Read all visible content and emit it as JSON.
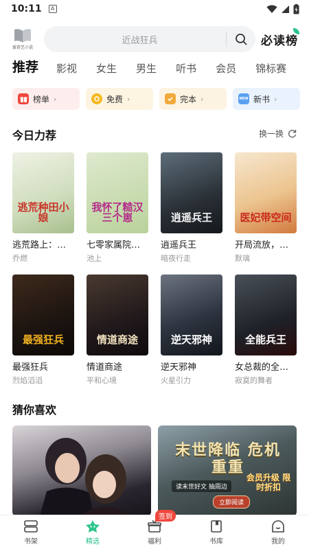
{
  "status_bar": {
    "time": "10:11",
    "notification_letter": "A"
  },
  "header": {
    "logo_caption": "爱奇艺小说",
    "search_placeholder": "近战狂兵",
    "brand": "必读榜"
  },
  "tabs": [
    {
      "label": "推荐",
      "active": true
    },
    {
      "label": "影视"
    },
    {
      "label": "女生"
    },
    {
      "label": "男生"
    },
    {
      "label": "听书"
    },
    {
      "label": "会员"
    },
    {
      "label": "锦标赛"
    }
  ],
  "pills": [
    {
      "label": "榜单",
      "icon": "gift-icon",
      "color": "#f0483e"
    },
    {
      "label": "免费",
      "icon": "coin-icon",
      "color": "#f5b820"
    },
    {
      "label": "完本",
      "icon": "check-shield-icon",
      "color": "#f2a93b"
    },
    {
      "label": "新书",
      "icon": "new-badge-icon",
      "color": "#5aa0f0",
      "icon_text": "NEW"
    }
  ],
  "recommend": {
    "title": "今日力荐",
    "refresh_label": "换一换",
    "books": [
      {
        "title": "逃荒路上：…",
        "author": "乔燃",
        "cover_text": "逃荒种田小娘",
        "bg": "linear-gradient(160deg,#eef2e4 0%,#cfdcbc 60%,#a7bf8d 100%)",
        "fg": "#c8372b"
      },
      {
        "title": "七零家属院…",
        "author": "池上",
        "cover_text": "我怀了糙汉三个崽",
        "bg": "linear-gradient(160deg,#dfe9cf 0%,#b9d29a 100%)",
        "fg": "#b52a8a"
      },
      {
        "title": "逍遥兵王",
        "author": "暗夜行走",
        "cover_text": "逍遥兵王",
        "bg": "linear-gradient(160deg,#5d6e7a 0%,#2a3036 60%,#14181c 100%)",
        "fg": "#f4f4f4"
      },
      {
        "title": "开局流放，…",
        "author": "默璃",
        "cover_text": "医妃带空间",
        "bg": "linear-gradient(160deg,#f6e7cf 0%,#ecc48f 55%,#d27a3e 100%)",
        "fg": "#c92a1e"
      },
      {
        "title": "最强狂兵",
        "author": "烈焰滔滔",
        "cover_text": "最强狂兵",
        "bg": "linear-gradient(160deg,#3e2a1c 0%,#1c1410 60%,#0c0907 100%)",
        "fg": "#f0b020"
      },
      {
        "title": "情道商途",
        "author": "平和心境",
        "cover_text": "情道商途",
        "bg": "linear-gradient(160deg,#4a3a30 0%,#20181a 60%,#0f0b0c 100%)",
        "fg": "#f2e2c0"
      },
      {
        "title": "逆天邪神",
        "author": "火星引力",
        "cover_text": "逆天邪神",
        "bg": "linear-gradient(160deg,#6c7480 0%,#2e3440 55%,#12161c 100%)",
        "fg": "#ffffff"
      },
      {
        "title": "女总裁的全…",
        "author": "寂寞的舞者",
        "cover_text": "全能兵王",
        "bg": "linear-gradient(160deg,#4a5058 0%,#1e2228 60%,#2a0a0a 100%)",
        "fg": "#ffffff"
      }
    ]
  },
  "guess": {
    "title": "猜你喜欢",
    "promo": {
      "headline": "末世降临 危机重重",
      "sub": "读末世好文 抽周边",
      "badge": "会员升级 限时折扣",
      "button": "立即阅读"
    }
  },
  "bottom_nav": [
    {
      "label": "书架",
      "icon": "bookshelf-icon"
    },
    {
      "label": "精选",
      "icon": "featured-icon",
      "active": true
    },
    {
      "label": "福利",
      "icon": "gift-box-icon",
      "badge": "签到"
    },
    {
      "label": "书库",
      "icon": "library-icon"
    },
    {
      "label": "我的",
      "icon": "profile-icon"
    }
  ]
}
